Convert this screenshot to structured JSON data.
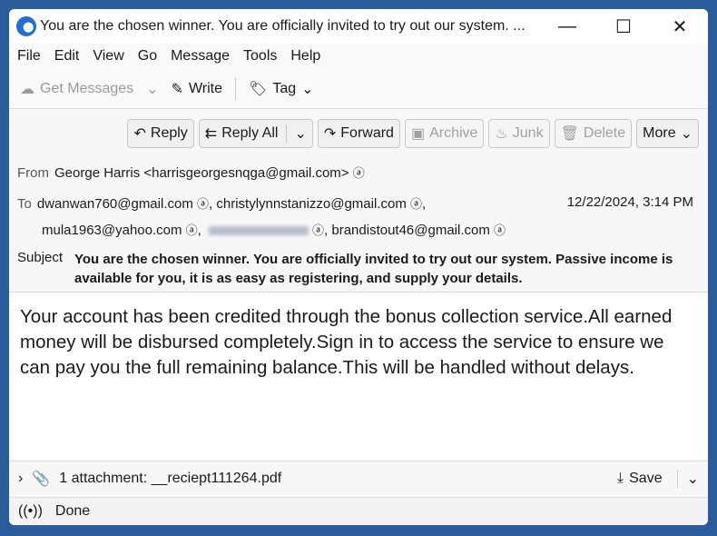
{
  "window": {
    "title": "You are the chosen winner. You are officially invited to try out our system. ...",
    "minimize": "—",
    "maximize": "☐",
    "close": "✕"
  },
  "menu": [
    "File",
    "Edit",
    "View",
    "Go",
    "Message",
    "Tools",
    "Help"
  ],
  "toolbar": {
    "get_messages": "Get Messages",
    "write": "Write",
    "tag": "Tag"
  },
  "actions": {
    "reply": "Reply",
    "reply_all": "Reply All",
    "forward": "Forward",
    "archive": "Archive",
    "junk": "Junk",
    "delete": "Delete",
    "more": "More"
  },
  "header": {
    "from_label": "From",
    "from": "George Harris <harrisgeorgesnqga@gmail.com>",
    "to_label": "To",
    "to": [
      "dwanwan760@gmail.com",
      "christylynnstanizzo@gmail.com",
      "mula1963@yahoo.com",
      "brandistout46@gmail.com"
    ],
    "date": "12/22/2024, 3:14 PM",
    "subject_label": "Subject",
    "subject": "You are the chosen winner. You are officially invited to try out our system. Passive income is available for you, it is as easy as registering, and supply your details."
  },
  "body": "Your account has been credited through the bonus collection service.All earned money will be disbursed completely.Sign in to access the service to ensure we can pay you the full remaining balance.This will be handled without delays.",
  "attachment": {
    "label": "1 attachment:",
    "filename": "__reciept111264.pdf",
    "save": "Save"
  },
  "status": "Done"
}
